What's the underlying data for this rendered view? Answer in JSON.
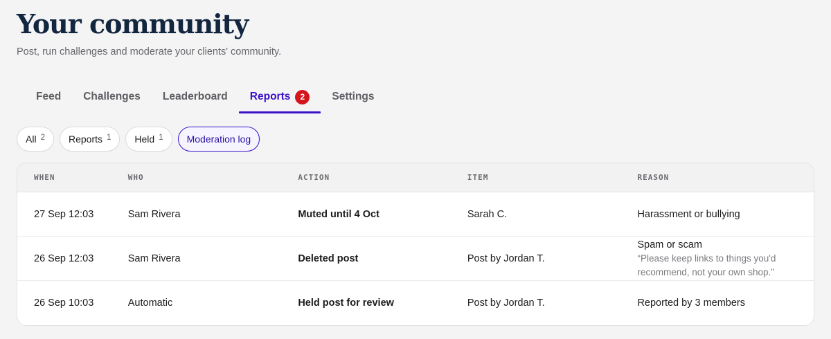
{
  "header": {
    "title": "Your community",
    "subtitle": "Post, run challenges and moderate your clients' community."
  },
  "tabs": [
    {
      "label": "Feed",
      "active": false
    },
    {
      "label": "Challenges",
      "active": false
    },
    {
      "label": "Leaderboard",
      "active": false
    },
    {
      "label": "Reports",
      "active": true,
      "badge": "2"
    },
    {
      "label": "Settings",
      "active": false
    }
  ],
  "filters": [
    {
      "label": "All",
      "count": "2",
      "active": false
    },
    {
      "label": "Reports",
      "count": "1",
      "active": false
    },
    {
      "label": "Held",
      "count": "1",
      "active": false
    },
    {
      "label": "Moderation log",
      "active": true
    }
  ],
  "table": {
    "columns": [
      "WHEN",
      "WHO",
      "ACTION",
      "ITEM",
      "REASON"
    ],
    "rows": [
      {
        "when": "27 Sep 12:03",
        "who": "Sam Rivera",
        "action": "Muted until 4 Oct",
        "item": "Sarah C.",
        "reason": "Harassment or bullying",
        "note": ""
      },
      {
        "when": "26 Sep 12:03",
        "who": "Sam Rivera",
        "action": "Deleted post",
        "item": "Post by Jordan T.",
        "reason": "Spam or scam",
        "note": "“Please keep links to things you'd recommend, not your own shop.”"
      },
      {
        "when": "26 Sep 10:03",
        "who": "Automatic",
        "action": "Held post for review",
        "item": "Post by Jordan T.",
        "reason": "Reported by 3 members",
        "note": ""
      }
    ]
  },
  "colors": {
    "accent": "#3b10c9",
    "badge": "#d4151e",
    "title": "#13263f"
  }
}
